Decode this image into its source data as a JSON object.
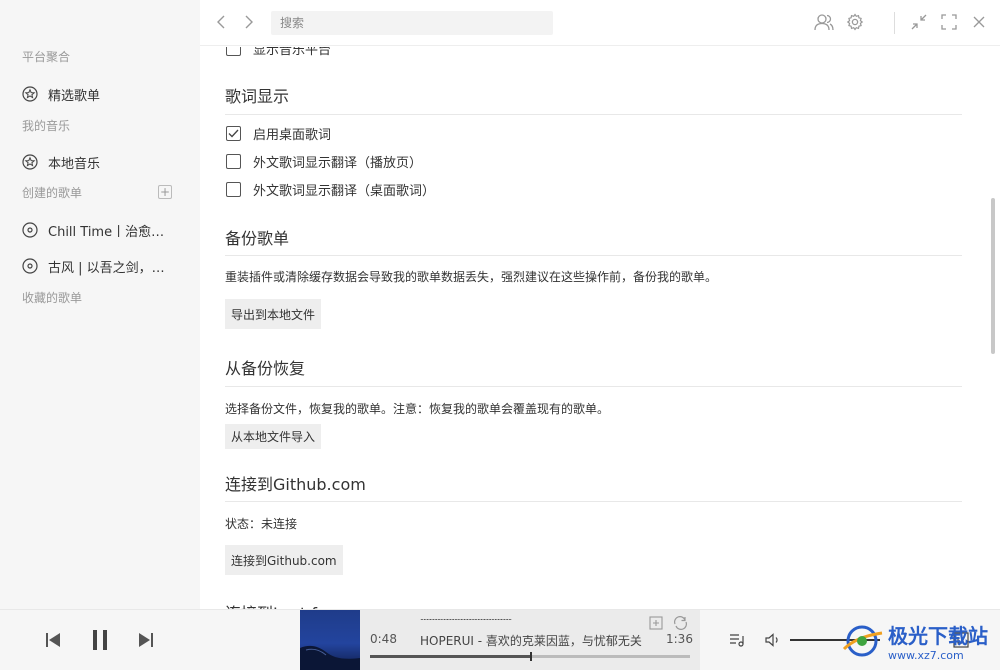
{
  "sidebar": {
    "sections": {
      "platform": "平台聚合",
      "my_music": "我的音乐",
      "created": "创建的歌单",
      "collected": "收藏的歌单"
    },
    "items": {
      "featured": "精选歌单",
      "local": "本地音乐",
      "playlist1": "Chill Time丨治愈且温暖的",
      "playlist2": "古风 | 以吾之剑，守护您"
    }
  },
  "topbar": {
    "search_placeholder": "搜索"
  },
  "content": {
    "partial_top": "显示音乐平台",
    "lyrics": {
      "title": "歌词显示",
      "options": [
        {
          "label": "启用桌面歌词",
          "checked": true
        },
        {
          "label": "外文歌词显示翻译（播放页）",
          "checked": false
        },
        {
          "label": "外文歌词显示翻译（桌面歌词）",
          "checked": false
        }
      ]
    },
    "backup": {
      "title": "备份歌单",
      "desc": "重装插件或清除缓存数据会导致我的歌单数据丢失，强烈建议在这些操作前，备份我的歌单。",
      "button": "导出到本地文件"
    },
    "restore": {
      "title": "从备份恢复",
      "desc": "选择备份文件，恢复我的歌单。注意：恢复我的歌单会覆盖现有的歌单。",
      "button": "从本地文件导入"
    },
    "github": {
      "title": "连接到Github.com",
      "status": "状态：未连接",
      "button": "连接到Github.com"
    },
    "partial_bottom": "连接到Last.fm"
  },
  "player": {
    "elapsed": "0:48",
    "duration": "1:36",
    "title": "HOPERUI - 喜欢的克莱因蓝，与忧郁无关",
    "lyric": "...........................................................",
    "progress": 0.5
  },
  "watermark": {
    "text": "极光下载站",
    "url": "www.xz7.com"
  }
}
